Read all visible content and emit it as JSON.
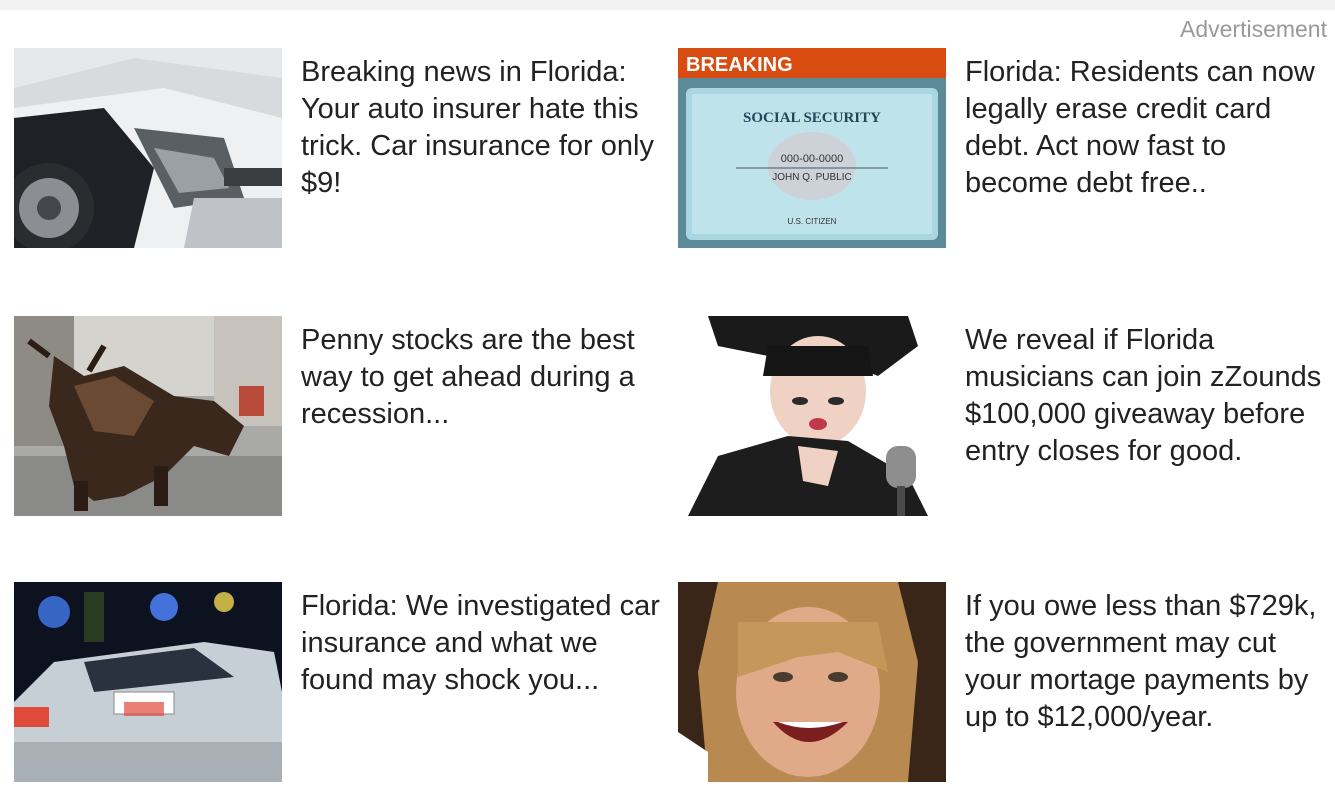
{
  "ad_label": "Advertisement",
  "ads": [
    {
      "headline": "Breaking news in Florida: Your auto insurer hate this trick. Car insurance for only $9!",
      "image": "crashed-car-image"
    },
    {
      "headline": "Florida: Residents can now legally erase credit card debt. Act now fast to become debt free..",
      "image": "social-security-card-image",
      "image_text": {
        "banner": "BREAKING",
        "card_title": "SOCIAL SECURITY",
        "card_number": "000-00-0000",
        "card_name": "JOHN Q. PUBLIC",
        "card_footer": "U.S. CITIZEN"
      }
    },
    {
      "headline": "Penny stocks are the best way to get ahead during a recession...",
      "image": "bull-statue-image"
    },
    {
      "headline": "We reveal if Florida musicians can join zZounds $100,000 giveaway before entry closes for good.",
      "image": "singer-microphone-image"
    },
    {
      "headline": "Florida: We investigated car insurance and what we found may shock you...",
      "image": "police-car-image"
    },
    {
      "headline": "If you owe less than $729k, the government may cut your mortage payments by up to $12,000/year.",
      "image": "smiling-woman-image"
    }
  ]
}
